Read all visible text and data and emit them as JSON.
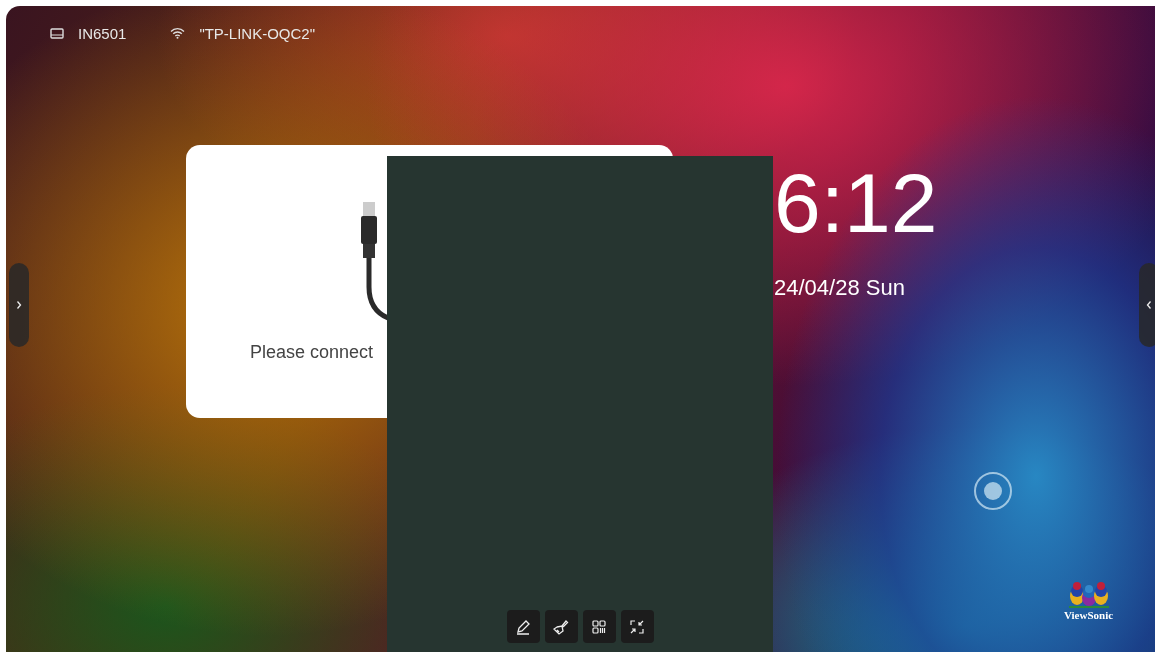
{
  "status_bar": [
    {
      "kind": "display",
      "label": "IN6501"
    },
    {
      "kind": "wifi",
      "label": "\"TP-LINK-OQC2\""
    }
  ],
  "connect_card": {
    "message": "Please connect"
  },
  "clock": {
    "time": "6:12",
    "date": "24/04/28 Sun"
  },
  "brand": {
    "logo_text": "ViewSonic"
  },
  "toolbar": [
    {
      "kind": "pen"
    },
    {
      "kind": "brush"
    },
    {
      "kind": "qr"
    },
    {
      "kind": "shrink"
    }
  ]
}
